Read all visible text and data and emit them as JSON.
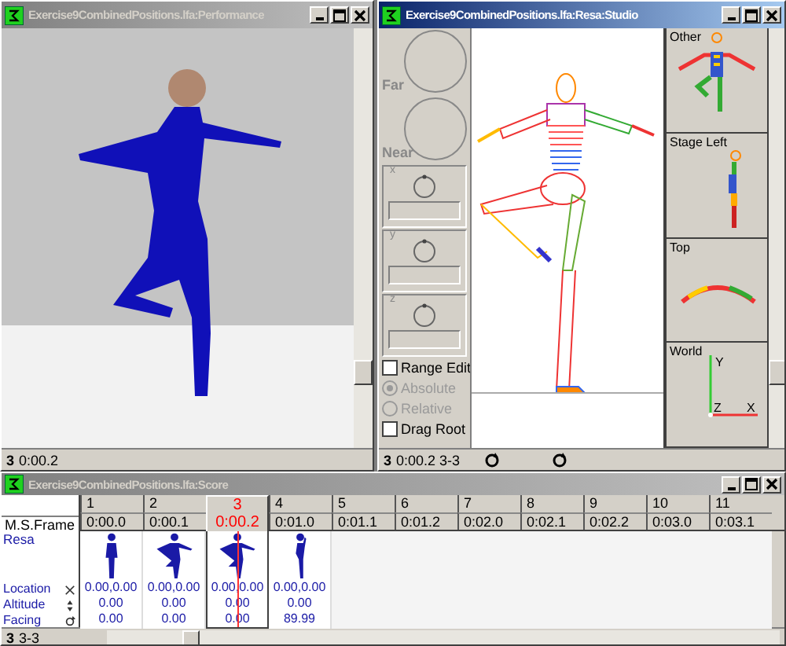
{
  "performance_window": {
    "title": "Exercise9CombinedPositions.lfa:Performance",
    "active": false,
    "status": [
      "3",
      "0:00.2"
    ]
  },
  "studio_window": {
    "title": "Exercise9CombinedPositions.lfa:Resa:Studio",
    "active": true,
    "dials": [
      {
        "label": "Far"
      },
      {
        "label": "Near"
      }
    ],
    "axis_panels": [
      {
        "label": "x"
      },
      {
        "label": "y"
      },
      {
        "label": "z"
      }
    ],
    "options": [
      {
        "kind": "checkbox",
        "label": "Range Edit",
        "checked": false,
        "disabled": false
      },
      {
        "kind": "radio",
        "label": "Absolute",
        "checked": true,
        "disabled": true
      },
      {
        "kind": "radio",
        "label": "Relative",
        "checked": false,
        "disabled": true
      },
      {
        "kind": "checkbox",
        "label": "Drag Root",
        "checked": false,
        "disabled": false
      }
    ],
    "views": [
      {
        "label": "Other",
        "kind": "front"
      },
      {
        "label": "Stage Left",
        "kind": "side"
      },
      {
        "label": "Top",
        "kind": "top"
      },
      {
        "label": "World",
        "kind": "axes"
      }
    ],
    "world_axes": [
      "Y",
      "Z",
      "X"
    ],
    "status": [
      "3",
      "0:00.2 3-3"
    ]
  },
  "score_window": {
    "title": "Exercise9CombinedPositions.lfa:Score",
    "active": false,
    "row_header": "M.S.Frame",
    "track": "Resa",
    "properties": [
      {
        "label": "Location",
        "kind": "move"
      },
      {
        "label": "Altitude",
        "kind": "height"
      },
      {
        "label": "Facing",
        "kind": "turn"
      }
    ],
    "frames": [
      {
        "number": "1",
        "time": "0:00.0",
        "selected": false,
        "kind": "standing",
        "values": [
          "0.00,0.00",
          "0.00",
          "0.00"
        ]
      },
      {
        "number": "2",
        "time": "0:00.1",
        "selected": false,
        "kind": "passe",
        "values": [
          "0.00,0.00",
          "0.00",
          "0.00"
        ]
      },
      {
        "number": "3",
        "time": "0:00.2",
        "selected": true,
        "kind": "passe",
        "values": [
          "0.00,0.00",
          "0.00",
          "0.00"
        ]
      },
      {
        "number": "4",
        "time": "0:01.0",
        "selected": false,
        "kind": "raised",
        "values": [
          "0.00,0.00",
          "0.00",
          "89.99"
        ]
      },
      {
        "number": "5",
        "time": "0:01.1",
        "selected": false
      },
      {
        "number": "6",
        "time": "0:01.2",
        "selected": false
      },
      {
        "number": "7",
        "time": "0:02.0",
        "selected": false
      },
      {
        "number": "8",
        "time": "0:02.1",
        "selected": false
      },
      {
        "number": "9",
        "time": "0:02.2",
        "selected": false
      },
      {
        "number": "10",
        "time": "0:03.0",
        "selected": false
      },
      {
        "number": "11",
        "time": "0:03.1",
        "selected": false
      }
    ],
    "status": [
      "3",
      "3-3"
    ]
  }
}
